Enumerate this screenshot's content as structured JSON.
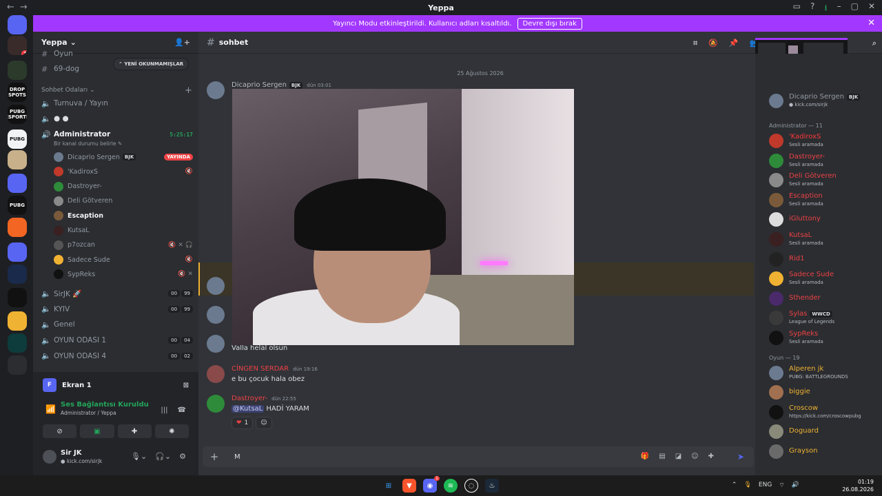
{
  "window": {
    "title": "Yeppa",
    "controls": [
      "▭",
      "?",
      "⭳",
      "–",
      "▢",
      "✕"
    ]
  },
  "banner": {
    "text": "Yayıncı Modu etkinleştirildi. Kullanıcı adları kısaltıldı.",
    "button": "Devre dışı bırak"
  },
  "servers": [
    {
      "label": "",
      "color": "#5865f2",
      "icon": "discord-icon"
    },
    {
      "label": "",
      "color": "#3a2b2b",
      "badge": "1",
      "icon": "server-avatar"
    },
    {
      "label": "",
      "color": "#2b3a2b",
      "icon": "server-avatar"
    },
    {
      "label": "DROP SPOTS",
      "color": "#111111",
      "icon": "server-logo"
    },
    {
      "label": "PUBG ESPORTS",
      "color": "#111111",
      "icon": "server-logo"
    },
    {
      "label": "PUBG",
      "color": "#f2f3f5",
      "icon": "server-logo"
    },
    {
      "label": "",
      "color": "#c8b08a",
      "icon": "server-avatar"
    },
    {
      "label": "",
      "color": "#5865f2",
      "icon": "folder-icon"
    },
    {
      "label": "PUBG",
      "color": "#111111",
      "icon": "server-logo"
    },
    {
      "label": "",
      "color": "#f26522",
      "icon": "server-logo"
    },
    {
      "label": "",
      "color": "#5865f2",
      "icon": "folder-icon"
    },
    {
      "label": "",
      "color": "#1a2a4a",
      "icon": "server-logo"
    },
    {
      "label": "",
      "color": "#111111",
      "icon": "server-logo"
    },
    {
      "label": "",
      "color": "#f0b232",
      "icon": "server-logo"
    },
    {
      "label": "",
      "color": "#0e3b3b",
      "icon": "server-logo"
    },
    {
      "label": "",
      "color": "#2b2d31",
      "icon": "explore-icon"
    }
  ],
  "guild": {
    "name": "Yeppa",
    "unread_pill": "YENİ OKUNMAMIŞLAR",
    "top_channels": [
      "Oyun",
      "69-dog"
    ],
    "voice_category": "Sohbet Odaları",
    "voice_channels": [
      {
        "name": "Turnuva / Yayın"
      },
      {
        "name": ""
      },
      {
        "name": "Administrator",
        "timer": "5:25:17",
        "status": "Bir kanal durumu belirle ✎"
      }
    ],
    "voice_users": [
      {
        "name": "Dicaprio Sergen",
        "tag": "BJK",
        "live": "YAYINDA",
        "color": "#6b7a8f"
      },
      {
        "name": "'KadiroxS",
        "color": "#c0392b",
        "icons": "🔇"
      },
      {
        "name": "Dastroyer-",
        "color": "#2e8b3a"
      },
      {
        "name": "Deli Götveren",
        "color": "#8a8a8a"
      },
      {
        "name": "Escaption",
        "color": "#7a5a3a",
        "bold": true
      },
      {
        "name": "KutsaL",
        "color": "#3a2020"
      },
      {
        "name": "p7ozcan",
        "color": "#555555",
        "icons": "🔇 ✕ 🎧"
      },
      {
        "name": "Sadece Sude",
        "color": "#f0b232",
        "icons": "🔇"
      },
      {
        "name": "SypReks",
        "color": "#111111",
        "icons": "🔇 ✕"
      }
    ],
    "more_channels": [
      {
        "name": "SirJK 🚀",
        "counts": [
          "00",
          "99"
        ]
      },
      {
        "name": "KYIV",
        "counts": [
          "00",
          "99"
        ]
      },
      {
        "name": "Genel",
        "counts": []
      },
      {
        "name": "OYUN ODASI 1",
        "counts": [
          "00",
          "04"
        ]
      },
      {
        "name": "OYUN ODASI 4",
        "counts": [
          "00",
          "02"
        ]
      }
    ]
  },
  "panel": {
    "screen": {
      "letter": "F",
      "label": "Ekran 1"
    },
    "connection": {
      "status": "Ses Bağlantısı Kuruldu",
      "location": "Administrator / Yeppa"
    },
    "buttons": [
      "video-off",
      "screen-share",
      "activities",
      "soundboard"
    ],
    "user": {
      "name": "Sir JK",
      "status": "kick.com/sirjk"
    }
  },
  "channel": {
    "name": "sohbet"
  },
  "chat": {
    "date_divider": "25 Ağustos 2026",
    "messages": [
      {
        "author": "Dicaprio Sergen",
        "tag": "BJK",
        "time": "dün 03:01",
        "body": "",
        "color": "#b5bac1"
      },
      {
        "author": "",
        "time": "",
        "body": "Valla helal olsun",
        "color": "#b5bac1"
      },
      {
        "author": "CİNGEN SERDAR",
        "time": "dün 19:16",
        "body": "e bu çocuk hala obez",
        "color": "#ed4245"
      },
      {
        "author": "Dastroyer-",
        "time": "dün 22:55",
        "mention": "@KutsaL",
        "body": " HADİ YARAM",
        "color": "#ed4245",
        "reaction": {
          "emoji": "❤",
          "count": "1"
        }
      }
    ],
    "composer": {
      "text": "M"
    }
  },
  "members": {
    "top_user": {
      "name": "Dicaprio Sergen",
      "tag": "BJK",
      "status": "kick.com/sirjk"
    },
    "groups": [
      {
        "title": "Administrator — 11",
        "users": [
          {
            "name": "'KadiroxS",
            "activity": "Sesli aramada",
            "color": "#ff3838",
            "av": "#c0392b"
          },
          {
            "name": "Dastroyer-",
            "activity": "Sesli aramada",
            "color": "#ed4245",
            "av": "#2e8b3a"
          },
          {
            "name": "Deli Götveren",
            "activity": "Sesli aramada",
            "color": "#ed4245",
            "av": "#8a8a8a"
          },
          {
            "name": "Escaption",
            "activity": "Sesli aramada",
            "color": "#ed4245",
            "av": "#7a5a3a"
          },
          {
            "name": "iGluttony",
            "activity": "",
            "color": "#ed4245",
            "av": "#dddddd"
          },
          {
            "name": "KutsaL",
            "activity": "Sesli aramada",
            "color": "#ed4245",
            "av": "#3a2020"
          },
          {
            "name": "Rid1",
            "activity": "",
            "color": "#ed4245",
            "av": "#222222"
          },
          {
            "name": "Sadece Sude",
            "activity": "Sesli aramada",
            "color": "#ed4245",
            "av": "#f0b232"
          },
          {
            "name": "Sthender",
            "activity": "",
            "color": "#ed4245",
            "av": "#4a2a6a"
          },
          {
            "name": "Sylas",
            "tag": "WWCD",
            "activity": "League of Legends",
            "color": "#ed4245",
            "av": "#3a3a3a"
          },
          {
            "name": "SypReks",
            "activity": "Sesli aramada",
            "color": "#ed4245",
            "av": "#111111"
          }
        ]
      },
      {
        "title": "Oyun — 19",
        "users": [
          {
            "name": "Alperen jk",
            "activity": "PUBG: BATTLEGROUNDS",
            "color": "#f0b232",
            "av": "#6b7a8f"
          },
          {
            "name": "biggie",
            "activity": "",
            "color": "#f0b232",
            "av": "#a07050"
          },
          {
            "name": "Croscow",
            "activity": "https://kick.com/croscowpubg",
            "color": "#f0b232",
            "av": "#111111"
          },
          {
            "name": "Doguard",
            "activity": "",
            "color": "#f0b232",
            "av": "#8a8a7a"
          },
          {
            "name": "Grayson",
            "activity": "",
            "color": "#f0b232",
            "av": "#6a6a6a"
          }
        ]
      }
    ]
  },
  "taskbar": {
    "lang": "ENG",
    "time": "01:19",
    "date": "26.08.2026",
    "discord_badge": "1"
  }
}
